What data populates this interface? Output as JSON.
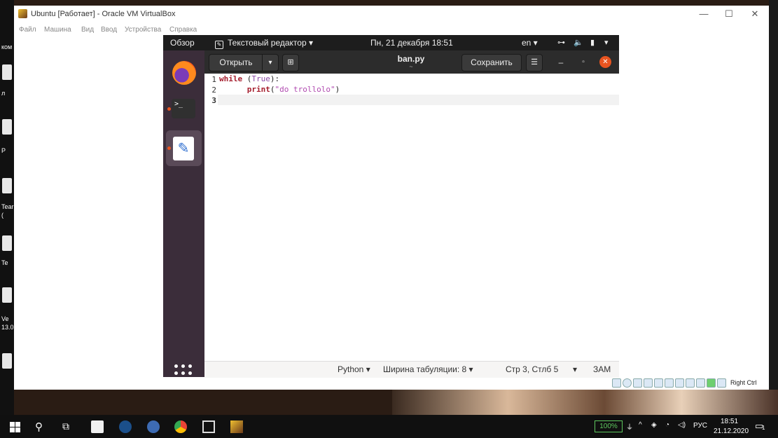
{
  "desktop": {
    "labels": [
      "ком",
      "л",
      "Р",
      "Tear",
      "(",
      "Te",
      "Ve",
      "13.0"
    ]
  },
  "vbox": {
    "title": "Ubuntu [Работает] - Oracle VM VirtualBox",
    "controls": {
      "minimize": "—",
      "maximize": "☐",
      "close": "✕"
    },
    "menu": [
      "Файл",
      "Машина",
      "Вид",
      "Ввод",
      "Устройства",
      "Справка"
    ],
    "host_key": "Right Ctrl"
  },
  "ubuntu": {
    "topbar": {
      "overview": "Обзор",
      "app_menu": "Текстовый редактор ▾",
      "clock": "Пн, 21 декабря  18:51",
      "lang": "en ▾",
      "network_icon": "network-icon",
      "volume_icon": "volume-icon",
      "battery_icon": "battery-icon",
      "menu_arrow": "▾"
    },
    "dock": {
      "firefox": "firefox-icon",
      "terminal_prompt": ">_",
      "editor": "text-editor-icon",
      "show_apps": "apps-grid-icon"
    }
  },
  "gedit": {
    "open_label": "Открыть",
    "open_drop": "▾",
    "newtab": "⊞",
    "filename": "ban.py",
    "file_path": "~",
    "save_label": "Сохранить",
    "menu": "☰",
    "minimize": "–",
    "maximize": "▫",
    "close": "✕",
    "lines": [
      "1",
      "2",
      "3"
    ],
    "code": {
      "l1_kw": "while",
      "l1_rest": " (",
      "l1_bool": "True",
      "l1_end": "):",
      "l2_indent": "      ",
      "l2_fn": "print",
      "l2_open": "(",
      "l2_str": "\"do trollolo\"",
      "l2_close": ")"
    },
    "status": {
      "language": "Python ▾",
      "tab_width": "Ширина табуляции: 8 ▾",
      "position": "Стр 3, Стлб 5",
      "pos_drop": "▾",
      "mode": "ЗАМ"
    }
  },
  "taskbar": {
    "battery": "100%",
    "lang": "РУС",
    "time": "18:51",
    "date": "21.12.2020",
    "notifications": "1"
  },
  "colors": {
    "ubuntu_orange": "#e95420",
    "dock_bg": "#3b2d3a",
    "keyword": "#a51d2d",
    "string": "#b04ab0"
  }
}
